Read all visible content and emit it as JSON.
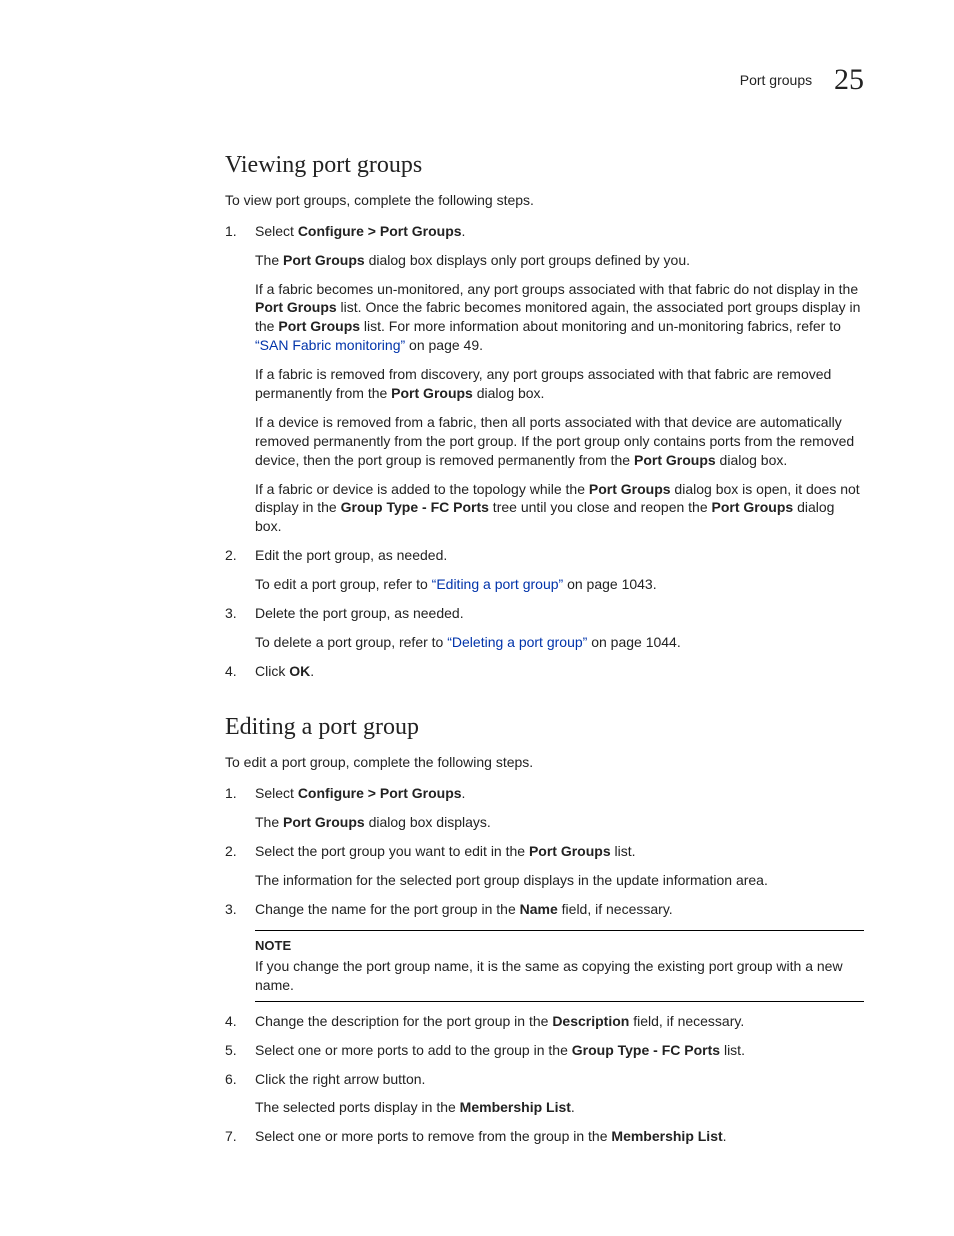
{
  "header": {
    "label": "Port groups",
    "chapter_number": "25"
  },
  "section1": {
    "title": "Viewing port groups",
    "intro": "To view port groups, complete the following steps.",
    "steps": [
      {
        "num": "1",
        "text_pre": "Select ",
        "text_bold": "Configure > Port Groups",
        "text_post": ".",
        "subs": [
          {
            "runs": [
              {
                "t": "The "
              },
              {
                "t": "Port Groups",
                "b": true
              },
              {
                "t": " dialog box displays only port groups defined by you."
              }
            ]
          },
          {
            "runs": [
              {
                "t": "If a fabric becomes un-monitored, any port groups associated with that fabric do not display in the "
              },
              {
                "t": "Port Groups",
                "b": true
              },
              {
                "t": " list. Once the fabric becomes monitored again, the associated port groups display in the "
              },
              {
                "t": "Port Groups",
                "b": true
              },
              {
                "t": " list. For more information about monitoring and un-monitoring fabrics, refer to "
              },
              {
                "t": "“SAN Fabric monitoring”",
                "link": true
              },
              {
                "t": " on page 49."
              }
            ]
          },
          {
            "runs": [
              {
                "t": "If a fabric is removed from discovery, any port groups associated with that fabric are removed permanently from the "
              },
              {
                "t": "Port Groups",
                "b": true
              },
              {
                "t": " dialog box."
              }
            ]
          },
          {
            "runs": [
              {
                "t": "If a device is removed from a fabric, then all ports associated with that device are automatically removed permanently from the port group. If the port group only contains ports from the removed device, then the port group is removed permanently from the "
              },
              {
                "t": "Port Groups",
                "b": true
              },
              {
                "t": " dialog box."
              }
            ]
          },
          {
            "runs": [
              {
                "t": "If a fabric or device is added to the topology while the "
              },
              {
                "t": "Port Groups",
                "b": true
              },
              {
                "t": " dialog box is open, it does not display in the "
              },
              {
                "t": "Group Type - FC Ports",
                "b": true
              },
              {
                "t": " tree until you close and reopen the "
              },
              {
                "t": "Port Groups",
                "b": true
              },
              {
                "t": " dialog box."
              }
            ]
          }
        ]
      },
      {
        "num": "2",
        "text_pre": "Edit the port group, as needed.",
        "subs": [
          {
            "runs": [
              {
                "t": "To edit a port group, refer to "
              },
              {
                "t": "“Editing a port group”",
                "link": true
              },
              {
                "t": " on page 1043."
              }
            ]
          }
        ]
      },
      {
        "num": "3",
        "text_pre": "Delete the port group, as needed.",
        "subs": [
          {
            "runs": [
              {
                "t": "To delete a port group, refer to "
              },
              {
                "t": "“Deleting a port group”",
                "link": true
              },
              {
                "t": " on page 1044."
              }
            ]
          }
        ]
      },
      {
        "num": "4",
        "text_pre": "Click ",
        "text_bold": "OK",
        "text_post": "."
      }
    ]
  },
  "section2": {
    "title": "Editing a port group",
    "intro": "To edit a port group, complete the following steps.",
    "steps": [
      {
        "num": "1",
        "text_pre": "Select ",
        "text_bold": "Configure > Port Groups",
        "text_post": ".",
        "subs": [
          {
            "runs": [
              {
                "t": "The "
              },
              {
                "t": "Port Groups",
                "b": true
              },
              {
                "t": " dialog box displays."
              }
            ]
          }
        ]
      },
      {
        "num": "2",
        "runs": [
          {
            "t": "Select the port group you want to edit in the "
          },
          {
            "t": "Port Groups",
            "b": true
          },
          {
            "t": " list."
          }
        ],
        "subs": [
          {
            "runs": [
              {
                "t": "The information for the selected port group displays in the update information area."
              }
            ]
          }
        ]
      },
      {
        "num": "3",
        "runs": [
          {
            "t": "Change the name for the port group in the "
          },
          {
            "t": "Name",
            "b": true
          },
          {
            "t": " field, if necessary."
          }
        ],
        "note": {
          "title": "NOTE",
          "text": "If you change the port group name, it is the same as copying the existing port group with a new name."
        }
      },
      {
        "num": "4",
        "runs": [
          {
            "t": "Change the description for the port group in the "
          },
          {
            "t": "Description",
            "b": true
          },
          {
            "t": " field, if necessary."
          }
        ]
      },
      {
        "num": "5",
        "runs": [
          {
            "t": "Select one or more ports to add to the group in the "
          },
          {
            "t": "Group Type - FC Ports",
            "b": true
          },
          {
            "t": " list."
          }
        ]
      },
      {
        "num": "6",
        "text_pre": "Click the right arrow button.",
        "subs": [
          {
            "runs": [
              {
                "t": "The selected ports display in the "
              },
              {
                "t": "Membership List",
                "b": true
              },
              {
                "t": "."
              }
            ]
          }
        ]
      },
      {
        "num": "7",
        "runs": [
          {
            "t": "Select one or more ports to remove from the group in the "
          },
          {
            "t": "Membership List",
            "b": true
          },
          {
            "t": "."
          }
        ]
      }
    ]
  }
}
